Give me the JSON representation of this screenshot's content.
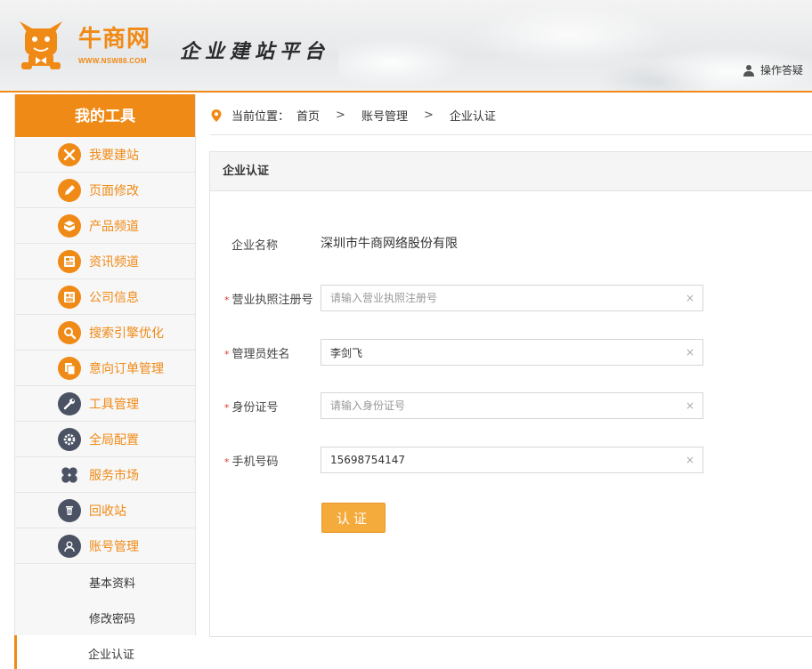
{
  "header": {
    "logo_text": "牛商网",
    "logo_url": "WWW.NSW88.COM",
    "slogan": "企业建站平台",
    "help_link": "操作答疑"
  },
  "sidebar": {
    "title": "我的工具",
    "items": [
      {
        "label": "我要建站",
        "icon": "tools-icon",
        "color": "#f08a16"
      },
      {
        "label": "页面修改",
        "icon": "pencil-icon",
        "color": "#f08a16"
      },
      {
        "label": "产品频道",
        "icon": "box-icon",
        "color": "#f08a16"
      },
      {
        "label": "资讯频道",
        "icon": "news-icon",
        "color": "#f08a16"
      },
      {
        "label": "公司信息",
        "icon": "id-card-icon",
        "color": "#f08a16"
      },
      {
        "label": "搜索引擎优化",
        "icon": "search-icon",
        "color": "#f08a16"
      },
      {
        "label": "意向订单管理",
        "icon": "document-icon",
        "color": "#f08a16"
      },
      {
        "label": "工具管理",
        "icon": "wrench-icon",
        "color": "#4a5263"
      },
      {
        "label": "全局配置",
        "icon": "gear-icon",
        "color": "#4a5263"
      },
      {
        "label": "服务市场",
        "icon": "clover-icon",
        "color": "#4a5263"
      },
      {
        "label": "回收站",
        "icon": "trash-icon",
        "color": "#4a5263"
      },
      {
        "label": "账号管理",
        "icon": "user-icon",
        "color": "#4a5263"
      }
    ],
    "sub_items": [
      {
        "label": "基本资料",
        "active": false
      },
      {
        "label": "修改密码",
        "active": false
      },
      {
        "label": "企业认证",
        "active": true
      }
    ]
  },
  "breadcrumb": {
    "prefix": "当前位置：",
    "sep": ">",
    "items": [
      "首页",
      "账号管理",
      "企业认证"
    ]
  },
  "panel": {
    "title": "企业认证",
    "company": {
      "label": "企业名称",
      "value": "深圳市牛商网络股份有限"
    },
    "fields": [
      {
        "label": "营业执照注册号",
        "required": true,
        "value": "",
        "placeholder": "请输入营业执照注册号"
      },
      {
        "label": "管理员姓名",
        "required": true,
        "value": "李剑飞",
        "placeholder": ""
      },
      {
        "label": "身份证号",
        "required": true,
        "value": "",
        "placeholder": "请输入身份证号"
      },
      {
        "label": "手机号码",
        "required": true,
        "value": "15698754147",
        "placeholder": ""
      }
    ],
    "required_mark": "*",
    "clear_glyph": "×",
    "submit_label": "认证"
  },
  "colors": {
    "accent": "#f08a16",
    "button": "#f5aa3c",
    "required": "#e5392d"
  }
}
